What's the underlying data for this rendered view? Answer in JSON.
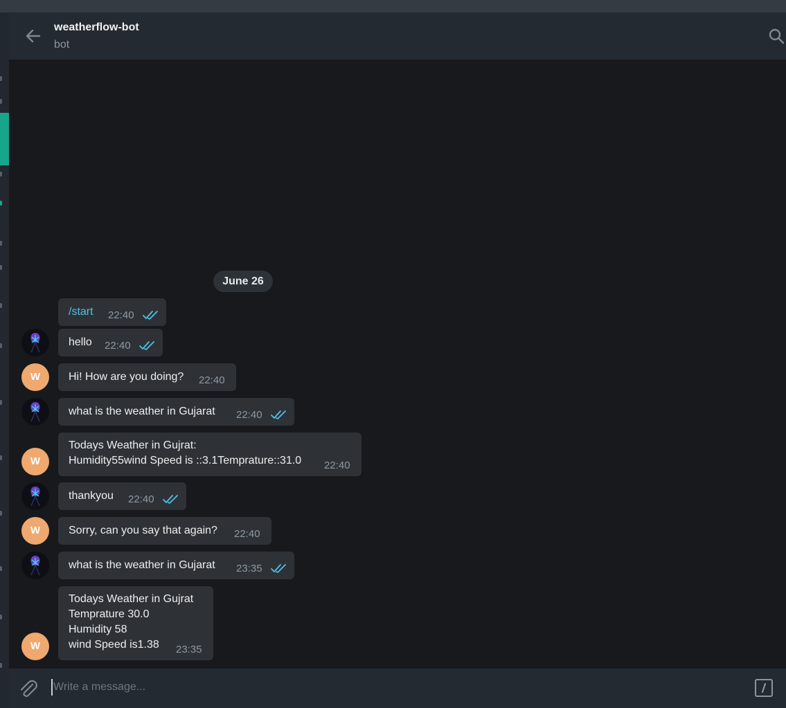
{
  "header": {
    "title": "weatherflow-bot",
    "subtitle": "bot"
  },
  "date_separator": "June 26",
  "messages": [
    {
      "text": "/start",
      "time": "22:40"
    },
    {
      "text": "hello",
      "time": "22:40"
    },
    {
      "avatar": "W",
      "text": "Hi! How are you doing?",
      "time": "22:40"
    },
    {
      "text": "what is the weather in Gujarat",
      "time": "22:40"
    },
    {
      "avatar": "W",
      "text": "Todays Weather in Gujrat:\nHumidity55wind Speed is ::3.1Temprature::31.0",
      "time": "22:40"
    },
    {
      "text": "thankyou",
      "time": "22:40"
    },
    {
      "avatar": "W",
      "text": "Sorry, can you say that again?",
      "time": "22:40"
    },
    {
      "text": "what is the weather in Gujarat",
      "time": "23:35"
    },
    {
      "avatar": "W",
      "text": "Todays Weather in Gujrat\nTemprature 30.0\nHumidity 58\nwind Speed is1.38",
      "time": "23:35"
    }
  ],
  "composer": {
    "placeholder": "Write a message..."
  },
  "colors": {
    "accent": "#17a58c",
    "check": "#4fc1e9",
    "bot_avatar": "#efa86e"
  },
  "icons": [
    "back-arrow-icon",
    "search-icon",
    "double-check-icon",
    "paperclip-icon",
    "bot-command-icon"
  ]
}
